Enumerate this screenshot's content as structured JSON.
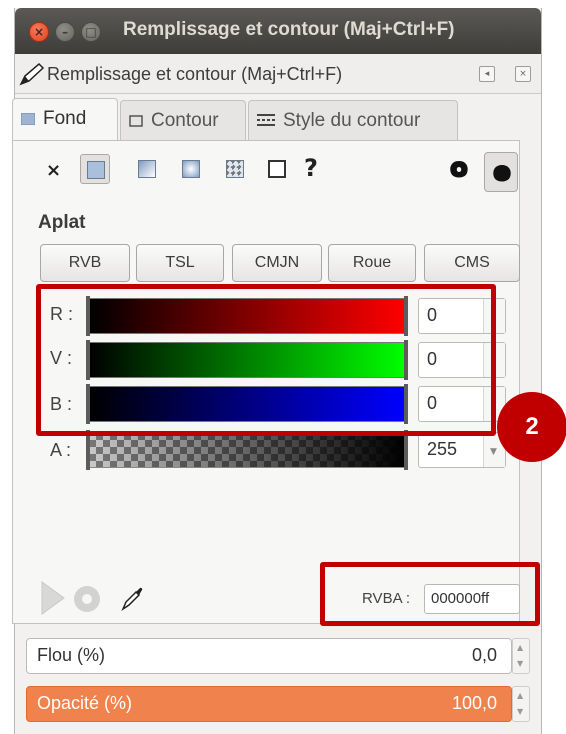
{
  "window": {
    "title": "Remplissage et contour (Maj+Ctrl+F)",
    "close_glyph": "×",
    "minimize_glyph": "–",
    "maximize_glyph": "□"
  },
  "dock": {
    "title": "Remplissage et contour (Maj+Ctrl+F)",
    "icon": "pen-fill-stroke-icon",
    "btn1_glyph": "◂",
    "btn2_glyph": "×"
  },
  "tabs": [
    {
      "label": "Fond",
      "icon": "fill-icon",
      "active": true
    },
    {
      "label": "Contour",
      "icon": "stroke-paint-icon",
      "active": false
    },
    {
      "label": "Style du contour",
      "icon": "stroke-style-icon",
      "active": false
    }
  ],
  "fill_types": {
    "none_glyph": "×",
    "unknown_glyph": "?",
    "items": [
      "flat-color",
      "linear-gradient",
      "radial-gradient",
      "pattern",
      "swatch"
    ],
    "selected": "flat-color"
  },
  "fill_mode": {
    "heading": "Aplat",
    "modes": [
      "RVB",
      "TSL",
      "CMJN",
      "Roue",
      "CMS"
    ]
  },
  "channels": [
    {
      "label": "R :",
      "value": "0",
      "color": "#ff0000"
    },
    {
      "label": "V :",
      "value": "0",
      "color": "#00ff00"
    },
    {
      "label": "B :",
      "value": "0",
      "color": "#0000ff"
    },
    {
      "label": "A :",
      "value": "255",
      "color": "#000000"
    }
  ],
  "annotation": {
    "badge": "2",
    "color": "#c00000"
  },
  "rgba": {
    "label": "RVBA :",
    "value": "000000ff"
  },
  "blur": {
    "label": "Flou (%)",
    "value": "0,0"
  },
  "opacity": {
    "label": "Opacité (%)",
    "value": "100,0",
    "fill_fraction": 1.0,
    "color": "#f0834d"
  }
}
